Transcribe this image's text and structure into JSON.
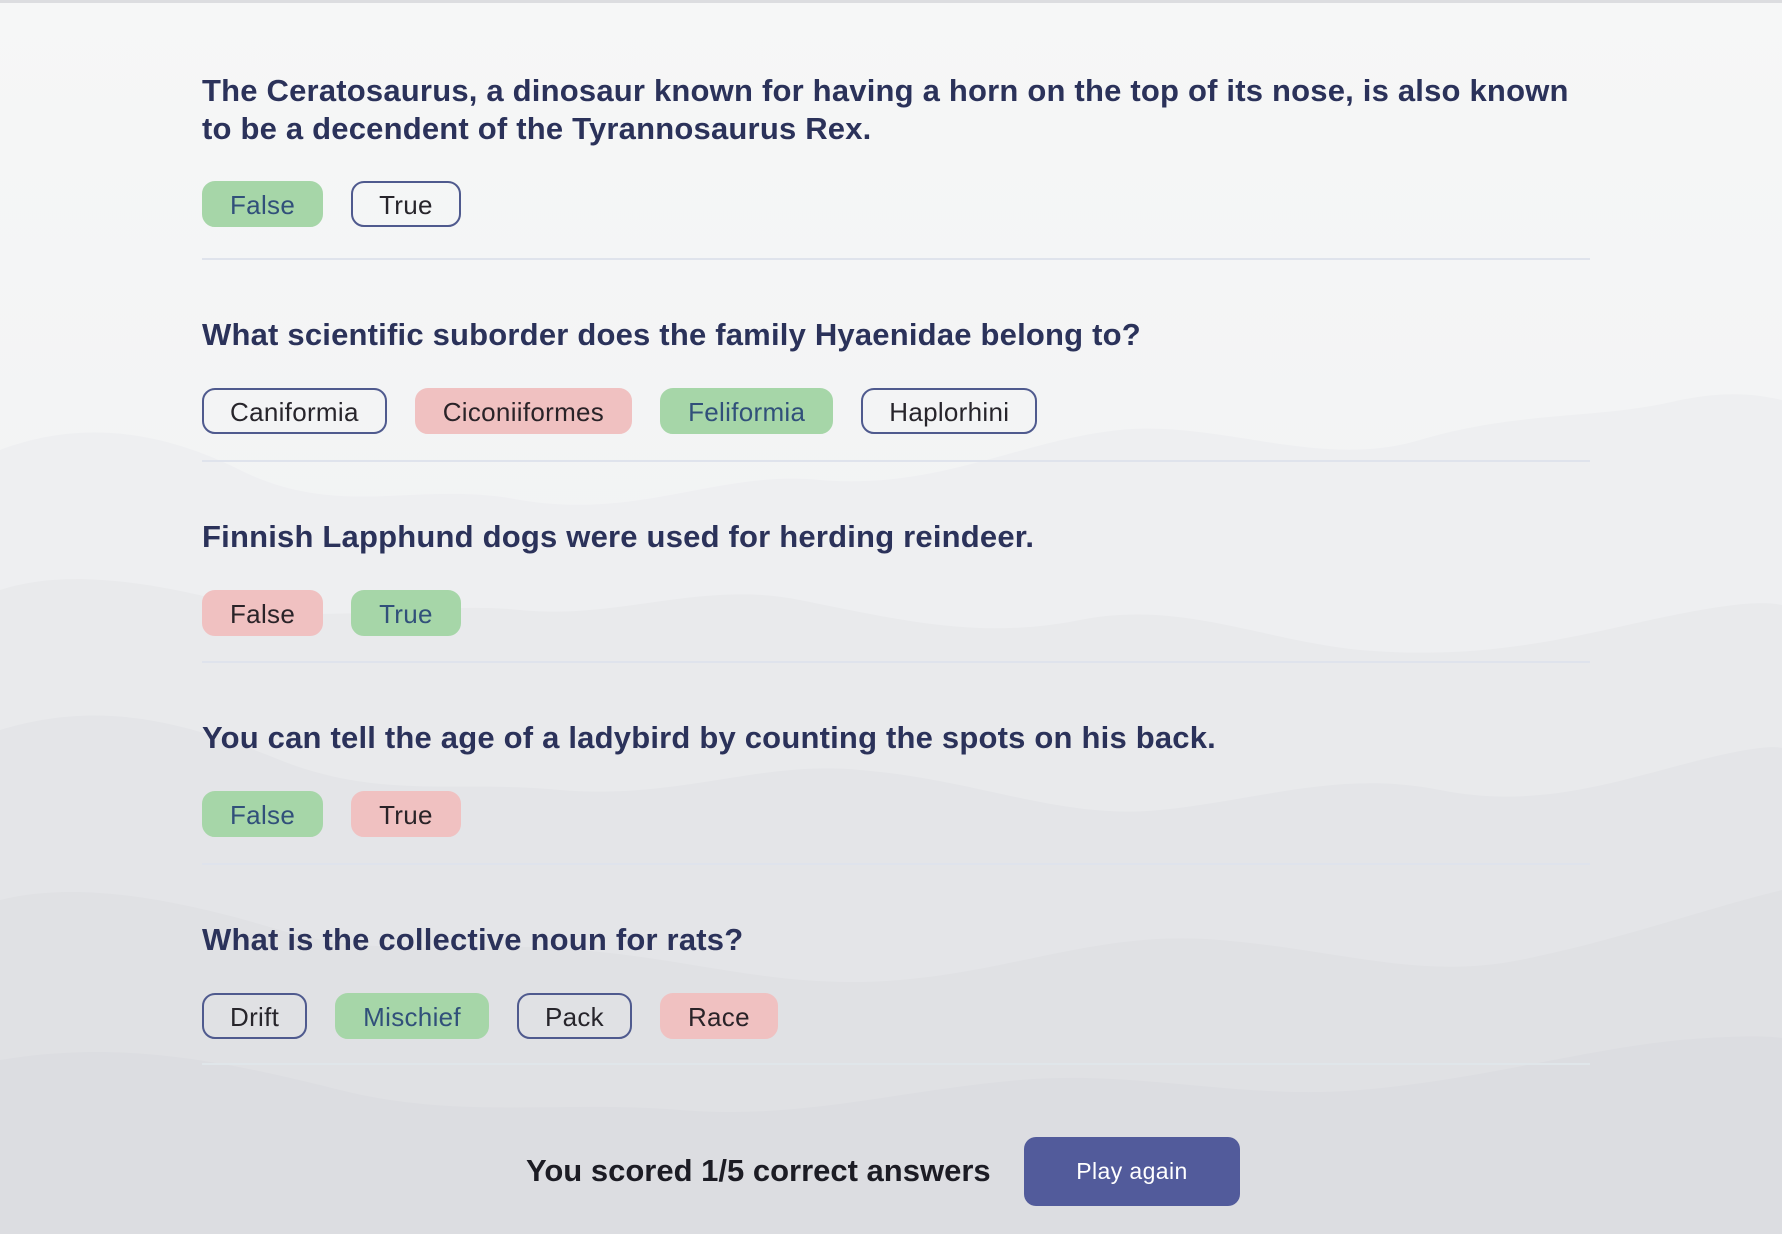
{
  "questions": [
    {
      "text": "The Ceratosaurus, a dinosaur known for having a horn on the top of its nose, is also known to be a decendent of the Tyrannosaurus Rex.",
      "answers": [
        {
          "label": "False",
          "state": "correct"
        },
        {
          "label": "True",
          "state": "neutral"
        }
      ]
    },
    {
      "text": "What scientific suborder does the family Hyaenidae belong to?",
      "answers": [
        {
          "label": "Caniformia",
          "state": "neutral"
        },
        {
          "label": "Ciconiiformes",
          "state": "wrong"
        },
        {
          "label": "Feliformia",
          "state": "correct"
        },
        {
          "label": "Haplorhini",
          "state": "neutral"
        }
      ]
    },
    {
      "text": "Finnish Lapphund dogs were used for herding reindeer.",
      "answers": [
        {
          "label": "False",
          "state": "wrong"
        },
        {
          "label": "True",
          "state": "correct"
        }
      ]
    },
    {
      "text": "You can tell the age of a ladybird by counting the spots on his back.",
      "answers": [
        {
          "label": "False",
          "state": "correct"
        },
        {
          "label": "True",
          "state": "wrong"
        }
      ]
    },
    {
      "text": "What is the collective noun for rats?",
      "answers": [
        {
          "label": "Drift",
          "state": "neutral"
        },
        {
          "label": "Mischief",
          "state": "correct"
        },
        {
          "label": "Pack",
          "state": "neutral"
        },
        {
          "label": "Race",
          "state": "wrong"
        }
      ]
    }
  ],
  "footer": {
    "score_text": "You scored 1/5 correct answers",
    "play_again_label": "Play again"
  },
  "colors": {
    "question_text": "#2b325a",
    "correct": "#a6d6a8",
    "wrong": "#f0c1c1",
    "neutral_border": "#4f5a8e",
    "button": "#525b9b"
  }
}
